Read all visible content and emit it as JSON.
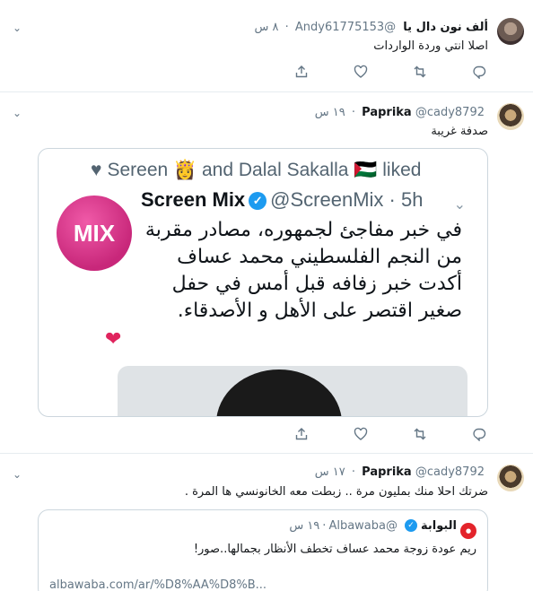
{
  "tweets": [
    {
      "username": "ألف نون دال يا",
      "handle": "@Andy61775153",
      "time": "٨ س",
      "text": "اصلا انتي وردة الواردات"
    },
    {
      "username": "Paprika",
      "handle": "@cady8792",
      "time": "١٩ س",
      "text": "صدفة غريبة"
    },
    {
      "username": "Paprika",
      "handle": "@cady8792",
      "time": "١٧ س",
      "text": "ضرتك احلا منك بمليون مرة .. زبطت معه الخانونسي ها المرة ."
    }
  ],
  "embedded_screenshot": {
    "liked_line": "Sereen 👸 and Dalal Sakalla 🇵🇸 liked",
    "logo_text": "MIX",
    "account_name": "Screen Mix",
    "account_handle": "@ScreenMix · 5h",
    "lines": [
      "في خبر مفاجئ لجمهوره، مصادر مقربة",
      "من النجم الفلسطيني محمد عساف",
      "أكدت خبر زفافه قبل أمس في حفل",
      "صغير اقتصر على الأهل و الأصدقاء."
    ],
    "ring": "💍",
    "heart": "❤"
  },
  "quoted": {
    "name": "البوابة",
    "handle": "@Albawaba",
    "time": "١٩ س",
    "text": "ريم عودة زوجة محمد عساف تخطف الأنظار بجمالها..صور!",
    "url": "albawaba.com/ar/%D8%AA%D8%B..."
  },
  "icons": {
    "reply": "reply-icon",
    "retweet": "retweet-icon",
    "like": "heart-icon",
    "share": "share-icon",
    "menu": "chevron-down-icon"
  },
  "colors": {
    "text": "#14171a",
    "muted": "#657786",
    "divider": "#e6ecf0",
    "verified": "#1d9bf0"
  }
}
